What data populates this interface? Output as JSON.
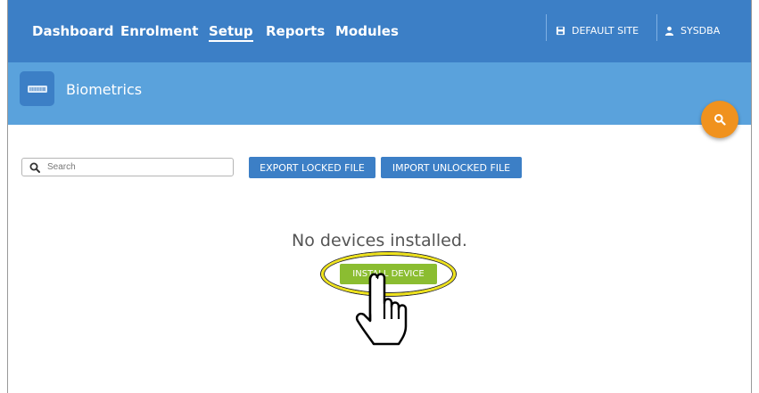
{
  "nav": {
    "items": [
      {
        "label": "Dashboard",
        "active": false
      },
      {
        "label": "Enrolment",
        "active": false
      },
      {
        "label": "Setup",
        "active": true
      },
      {
        "label": "Reports",
        "active": false
      },
      {
        "label": "Modules",
        "active": false
      }
    ],
    "site_label": "DEFAULT SITE",
    "user_label": "SYSDBA"
  },
  "module": {
    "title": "Biometrics",
    "icon": "biometric-reader-icon"
  },
  "toolbar": {
    "search_placeholder": "Search",
    "export_label": "EXPORT LOCKED FILE",
    "import_label": "IMPORT UNLOCKED FILE"
  },
  "empty_state": {
    "message": "No devices installed.",
    "install_label": "INSTALL DEVICE"
  },
  "colors": {
    "nav": "#3c7fc6",
    "subheader": "#5aa2dc",
    "fab": "#f0921e",
    "install": "#8bbd31",
    "highlight": "#eee21a"
  }
}
